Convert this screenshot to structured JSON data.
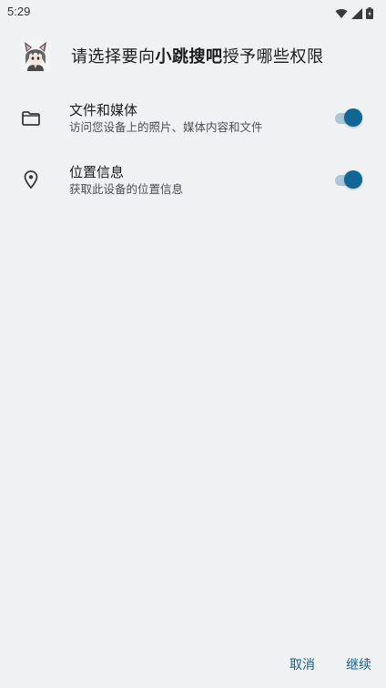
{
  "status_bar": {
    "time": "5:29",
    "icons": [
      "wifi-icon",
      "signal-icon",
      "battery-icon"
    ]
  },
  "dialog": {
    "title_prefix": "请选择要向",
    "app_name": "小跳搜吧",
    "title_suffix": "授予哪些权限"
  },
  "permissions": [
    {
      "title": "文件和媒体",
      "description": "访问您设备上的照片、媒体内容和文件",
      "icon": "folder-icon",
      "enabled": true
    },
    {
      "title": "位置信息",
      "description": "获取此设备的位置信息",
      "icon": "location-pin-icon",
      "enabled": true
    }
  ],
  "actions": {
    "cancel": "取消",
    "continue": "继续"
  },
  "colors": {
    "background": "#eff1f3",
    "accent": "#0f6795",
    "track": "#a9c7d8",
    "button_text": "#17618c"
  }
}
